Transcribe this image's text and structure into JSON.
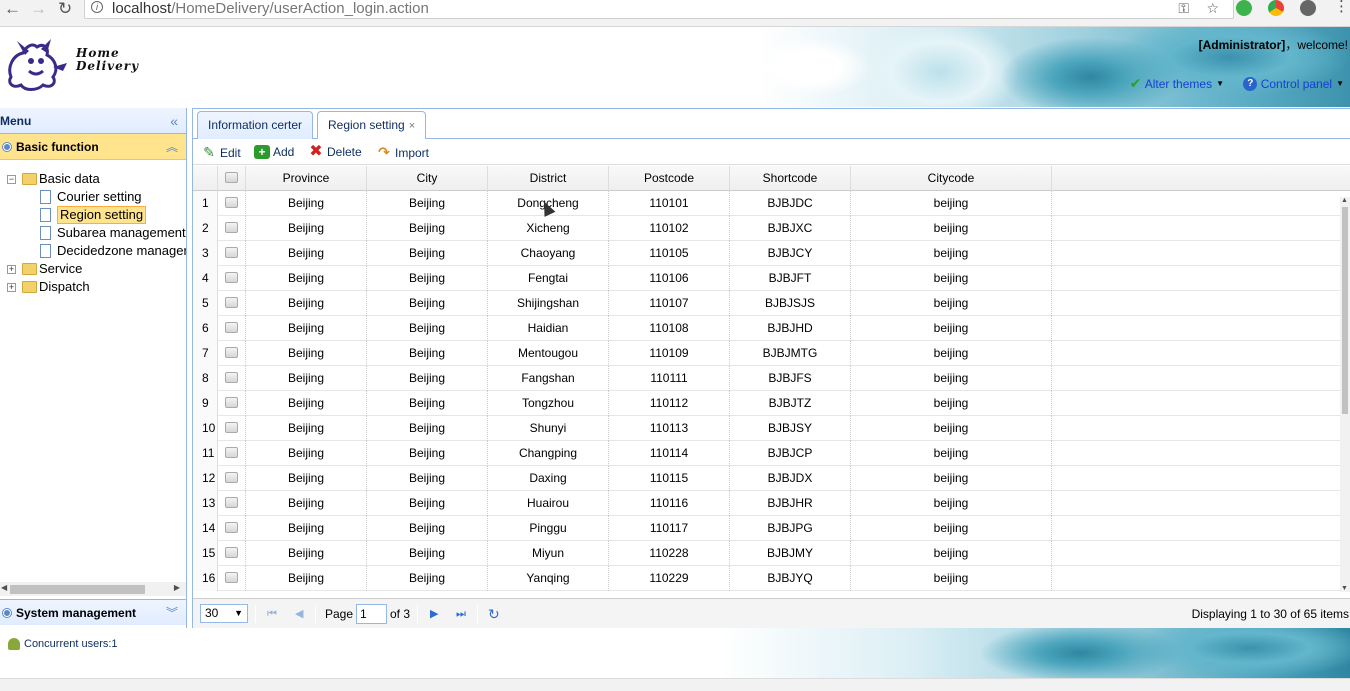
{
  "browser": {
    "back_icon": "←",
    "forward_icon": "→",
    "reload_icon": "↻",
    "url_host": "localhost",
    "url_path": "/HomeDelivery/userAction_login.action"
  },
  "header": {
    "logo_line1": "Home",
    "logo_line2": "Delivery",
    "welcome_user": "[Administrator]",
    "welcome_text": "，welcome!",
    "alter_themes": "Alter themes",
    "control_panel": "Control panel"
  },
  "menu": {
    "title": "Menu",
    "basic_function": "Basic function",
    "system_management": "System management",
    "tree": [
      {
        "label": "Basic data",
        "level": 0,
        "type": "folder",
        "expanded": true
      },
      {
        "label": "Courier setting",
        "level": 1,
        "type": "file"
      },
      {
        "label": "Region setting",
        "level": 1,
        "type": "file",
        "selected": true
      },
      {
        "label": "Subarea management",
        "level": 1,
        "type": "file"
      },
      {
        "label": "Decidedzone management",
        "level": 1,
        "type": "file"
      },
      {
        "label": "Service",
        "level": 0,
        "type": "folder",
        "expanded": false
      },
      {
        "label": "Dispatch",
        "level": 0,
        "type": "folder",
        "expanded": false
      }
    ]
  },
  "tabs": [
    {
      "label": "Information certer",
      "active": false
    },
    {
      "label": "Region setting",
      "active": true,
      "closable": true
    }
  ],
  "toolbar": {
    "edit": "Edit",
    "add": "Add",
    "delete": "Delete",
    "import": "Import"
  },
  "grid": {
    "columns": [
      "Province",
      "City",
      "District",
      "Postcode",
      "Shortcode",
      "Citycode"
    ],
    "rows": [
      [
        "1",
        "Beijing",
        "Beijing",
        "Dongcheng",
        "110101",
        "BJBJDC",
        "beijing"
      ],
      [
        "2",
        "Beijing",
        "Beijing",
        "Xicheng",
        "110102",
        "BJBJXC",
        "beijing"
      ],
      [
        "3",
        "Beijing",
        "Beijing",
        "Chaoyang",
        "110105",
        "BJBJCY",
        "beijing"
      ],
      [
        "4",
        "Beijing",
        "Beijing",
        "Fengtai",
        "110106",
        "BJBJFT",
        "beijing"
      ],
      [
        "5",
        "Beijing",
        "Beijing",
        "Shijingshan",
        "110107",
        "BJBJSJS",
        "beijing"
      ],
      [
        "6",
        "Beijing",
        "Beijing",
        "Haidian",
        "110108",
        "BJBJHD",
        "beijing"
      ],
      [
        "7",
        "Beijing",
        "Beijing",
        "Mentougou",
        "110109",
        "BJBJMTG",
        "beijing"
      ],
      [
        "8",
        "Beijing",
        "Beijing",
        "Fangshan",
        "110111",
        "BJBJFS",
        "beijing"
      ],
      [
        "9",
        "Beijing",
        "Beijing",
        "Tongzhou",
        "110112",
        "BJBJTZ",
        "beijing"
      ],
      [
        "10",
        "Beijing",
        "Beijing",
        "Shunyi",
        "110113",
        "BJBJSY",
        "beijing"
      ],
      [
        "11",
        "Beijing",
        "Beijing",
        "Changping",
        "110114",
        "BJBJCP",
        "beijing"
      ],
      [
        "12",
        "Beijing",
        "Beijing",
        "Daxing",
        "110115",
        "BJBJDX",
        "beijing"
      ],
      [
        "13",
        "Beijing",
        "Beijing",
        "Huairou",
        "110116",
        "BJBJHR",
        "beijing"
      ],
      [
        "14",
        "Beijing",
        "Beijing",
        "Pinggu",
        "110117",
        "BJBJPG",
        "beijing"
      ],
      [
        "15",
        "Beijing",
        "Beijing",
        "Miyun",
        "110228",
        "BJBJMY",
        "beijing"
      ],
      [
        "16",
        "Beijing",
        "Beijing",
        "Yanqing",
        "110229",
        "BJBJYQ",
        "beijing"
      ]
    ]
  },
  "pager": {
    "page_size": "30",
    "page_label": "Page",
    "page_value": "1",
    "of_label": "of 3",
    "display_info": "Displaying 1 to 30 of 65 items"
  },
  "footer": {
    "concurrent_users": "Concurrent users:1"
  },
  "colors": {
    "accent": "#95b8e7",
    "selected": "#ffe48d",
    "link": "#1540d0"
  }
}
